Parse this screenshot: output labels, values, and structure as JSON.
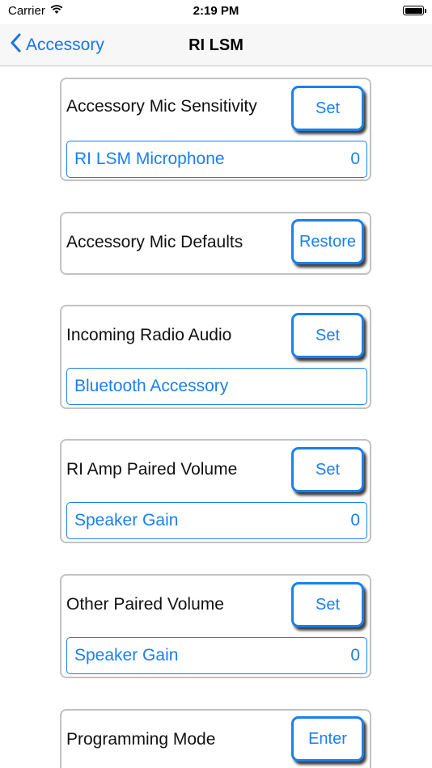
{
  "status_bar": {
    "carrier": "Carrier",
    "time": "2:19 PM",
    "battery_level": 1.0
  },
  "nav": {
    "back_label": "Accessory",
    "title": "RI LSM"
  },
  "cards": [
    {
      "label": "Accessory Mic Sensitivity",
      "button": "Set",
      "field_text": "RI LSM Microphone",
      "field_value": "0"
    },
    {
      "label": "Accessory Mic Defaults",
      "button": "Restore"
    },
    {
      "label": "Incoming Radio Audio",
      "button": "Set",
      "field_text": "Bluetooth Accessory",
      "field_value": ""
    },
    {
      "label": "RI Amp Paired Volume",
      "button": "Set",
      "field_text": "Speaker Gain",
      "field_value": "0"
    },
    {
      "label": "Other Paired Volume",
      "button": "Set",
      "field_text": "Speaker Gain",
      "field_value": "0"
    },
    {
      "label": "Programming Mode",
      "button": "Enter"
    }
  ],
  "colors": {
    "accent": "#1a7ff0",
    "card_border": "#c2c2c2",
    "nav_background": "#f7f7f7"
  }
}
